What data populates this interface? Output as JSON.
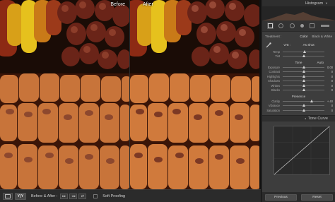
{
  "viewer": {
    "before_label": "Before",
    "after_label": "After"
  },
  "toolbar": {
    "view_mode": "Y|Y",
    "compare_label": "Before & After :",
    "soft_proofing_label": "Soft Proofing"
  },
  "panel": {
    "histogram_title": "Histogram",
    "treatment_label": "Treatment :",
    "treatment_color": "Color",
    "treatment_bw": "Black & White",
    "wb_label": "WB :",
    "wb_value": "As Shot",
    "wb_sliders": [
      {
        "label": "Temp",
        "pos": 0.52,
        "value": ""
      },
      {
        "label": "Tint",
        "pos": 0.5,
        "value": ""
      }
    ],
    "tone_label": "Tone",
    "tone_auto": "Auto",
    "tone_sliders": [
      {
        "label": "Exposure",
        "pos": 0.5,
        "value": "0.00"
      },
      {
        "label": "Contrast",
        "pos": 0.5,
        "value": "0"
      },
      {
        "label": "Highlights",
        "pos": 0.5,
        "value": "0"
      },
      {
        "label": "Shadows",
        "pos": 0.5,
        "value": "0"
      },
      {
        "label": "Whites",
        "pos": 0.5,
        "value": "0"
      },
      {
        "label": "Blacks",
        "pos": 0.5,
        "value": "0"
      }
    ],
    "presence_label": "Presence",
    "presence_sliders": [
      {
        "label": "Clarity",
        "pos": 0.7,
        "value": "+ 40"
      },
      {
        "label": "Vibrance",
        "pos": 0.5,
        "value": "0"
      },
      {
        "label": "Saturation",
        "pos": 0.5,
        "value": "0"
      }
    ],
    "tone_curve_title": "Tone Curve",
    "previous_label": "Previous",
    "reset_label": "Reset"
  },
  "colors": {
    "panel_bg": "#3d3d3d",
    "corn_orange": "#c8743a",
    "corn_yellow": "#e2b21e",
    "corn_red": "#7a2418"
  }
}
